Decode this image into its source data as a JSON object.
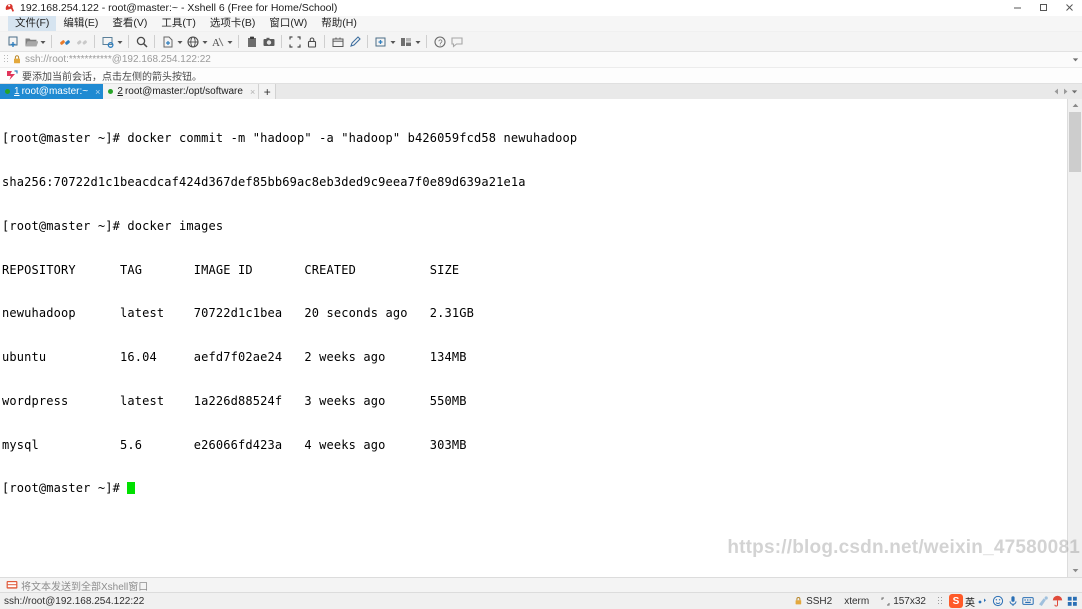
{
  "window": {
    "title": "192.168.254.122 - root@master:~ - Xshell 6 (Free for Home/School)",
    "app_icon": "xshell-icon",
    "controls": {
      "minimize": "minimize-icon",
      "restore": "restore-icon",
      "close": "close-icon"
    }
  },
  "menubar": {
    "items": [
      {
        "label": "文件(F)",
        "name": "menu-file"
      },
      {
        "label": "编辑(E)",
        "name": "menu-edit"
      },
      {
        "label": "查看(V)",
        "name": "menu-view"
      },
      {
        "label": "工具(T)",
        "name": "menu-tools"
      },
      {
        "label": "选项卡(B)",
        "name": "menu-tabs"
      },
      {
        "label": "窗口(W)",
        "name": "menu-window"
      },
      {
        "label": "帮助(H)",
        "name": "menu-help"
      }
    ]
  },
  "toolbar": {
    "buttons": [
      "new-session-icon",
      "open-session-icon",
      "reconnect-icon",
      "disconnect-icon",
      "session-properties-icon",
      "find-icon",
      "transfer-file-icon",
      "ftp-icon",
      "font-icon",
      "paste-icon",
      "capture-icon",
      "fullscreen-icon",
      "lock-icon",
      "log-icon",
      "compose-icon",
      "new-tab-icon",
      "arrange-icon",
      "help-icon",
      "feedback-icon"
    ]
  },
  "addressbar": {
    "lock_icon": "lock-icon",
    "url": "ssh://root:***********@192.168.254.122:22",
    "dropdown_icon": "chevron-down-icon"
  },
  "hintbar": {
    "icon": "add-session-icon",
    "text": "要添加当前会话，点击左侧的箭头按钮。"
  },
  "tabs": {
    "items": [
      {
        "number": "1",
        "label": "root@master:~",
        "active": true,
        "status": "connected"
      },
      {
        "number": "2",
        "label": "root@master:/opt/software",
        "active": false,
        "status": "connected"
      }
    ],
    "add_label": "+",
    "close_label": "×",
    "nav_prev": "◀",
    "nav_next": "▶",
    "nav_list": "▾"
  },
  "terminal": {
    "prompt": "[root@master ~]# ",
    "lines": [
      "[root@master ~]# docker commit -m \"hadoop\" -a \"hadoop\" b426059fcd58 newuhadoop",
      "sha256:70722d1c1beacdcaf424d367def85bb69ac8eb3ded9c9eea7f0e89d639a21e1a",
      "[root@master ~]# docker images",
      "REPOSITORY      TAG       IMAGE ID       CREATED          SIZE",
      "newuhadoop      latest    70722d1c1bea   20 seconds ago   2.31GB",
      "ubuntu          16.04     aefd7f02ae24   2 weeks ago      134MB",
      "wordpress       latest    1a226d88524f   3 weeks ago      550MB",
      "mysql           5.6       e26066fd423a   4 weeks ago      303MB"
    ],
    "last_prompt": "[root@master ~]# ",
    "cursor": "block",
    "cursor_color": "#00e000",
    "docker_images_table": {
      "headers": [
        "REPOSITORY",
        "TAG",
        "IMAGE ID",
        "CREATED",
        "SIZE"
      ],
      "rows": [
        [
          "newuhadoop",
          "latest",
          "70722d1c1bea",
          "20 seconds ago",
          "2.31GB"
        ],
        [
          "ubuntu",
          "16.04",
          "aefd7f02ae24",
          "2 weeks ago",
          "134MB"
        ],
        [
          "wordpress",
          "latest",
          "1a226d88524f",
          "3 weeks ago",
          "550MB"
        ],
        [
          "mysql",
          "5.6",
          "e26066fd423a",
          "4 weeks ago",
          "303MB"
        ]
      ]
    }
  },
  "watermark": {
    "text": "https://blog.csdn.net/weixin_47580081"
  },
  "sendbar": {
    "icon": "send-to-all-icon",
    "text": "将文本发送到全部Xshell窗口"
  },
  "statusbar": {
    "connection": "ssh://root@192.168.254.122:22",
    "protocol": "SSH2",
    "terminal_type": "xterm",
    "size": "157x32",
    "size_icon": "resize-icon",
    "lock_icon": "lock-icon",
    "ime": {
      "logo": "S",
      "mode": "英",
      "items": [
        "keyboard-icon",
        "emoji-icon",
        "voice-icon",
        "panel-icon",
        "skin-icon",
        "umbrella-icon",
        "apps-icon"
      ]
    }
  },
  "colors": {
    "tab_active_bg": "#1f8ad2",
    "terminal_bg": "#ffffff",
    "terminal_fg": "#000000",
    "cursor": "#00e000",
    "status_dot": "#27a327"
  }
}
